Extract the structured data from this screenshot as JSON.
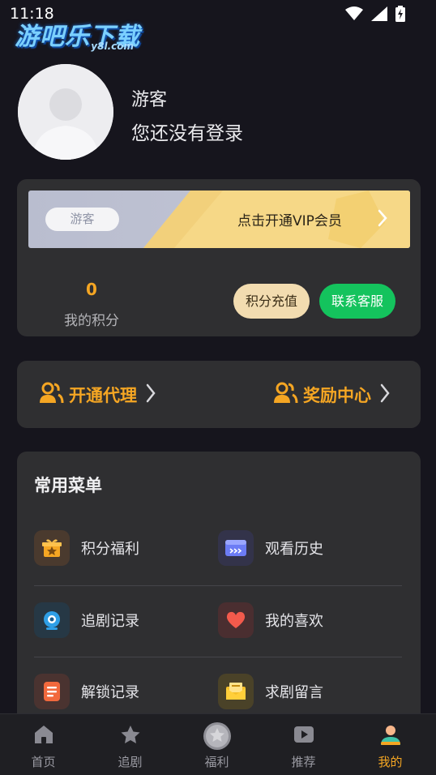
{
  "status_bar": {
    "time": "11:18",
    "wifi_icon": "wifi-icon",
    "signal_icon": "signal-icon",
    "battery_icon": "battery-charging-icon"
  },
  "watermark": {
    "main": "游吧乐下载",
    "sub": "y8l.com"
  },
  "profile": {
    "nickname": "游客",
    "login_tip": "您还没有登录"
  },
  "vip": {
    "badge": "游客",
    "promo": "点击开通VIP会员",
    "points_value": "0",
    "points_label": "我的积分",
    "recharge_label": "积分充值",
    "service_label": "联系客服"
  },
  "agent": {
    "open_agent": "开通代理",
    "reward_center": "奖励中心"
  },
  "menu": {
    "title": "常用菜单",
    "items": [
      {
        "label": "积分福利",
        "icon": "gift-star-icon"
      },
      {
        "label": "观看历史",
        "icon": "history-film-icon"
      },
      {
        "label": "追剧记录",
        "icon": "webcam-icon"
      },
      {
        "label": "我的喜欢",
        "icon": "heart-icon"
      },
      {
        "label": "解锁记录",
        "icon": "document-list-icon"
      },
      {
        "label": "求剧留言",
        "icon": "message-envelope-icon"
      }
    ]
  },
  "tabs": [
    {
      "label": "首页",
      "icon": "home-icon",
      "active": false
    },
    {
      "label": "追剧",
      "icon": "star-icon",
      "active": false
    },
    {
      "label": "福利",
      "icon": "welfare-star-badge-icon",
      "active": false
    },
    {
      "label": "推荐",
      "icon": "play-icon",
      "active": false
    },
    {
      "label": "我的",
      "icon": "profile-icon",
      "active": true
    }
  ],
  "colors": {
    "accent": "#f5a623",
    "green": "#14c35d",
    "card": "#2f2f31",
    "background": "#16151d"
  }
}
